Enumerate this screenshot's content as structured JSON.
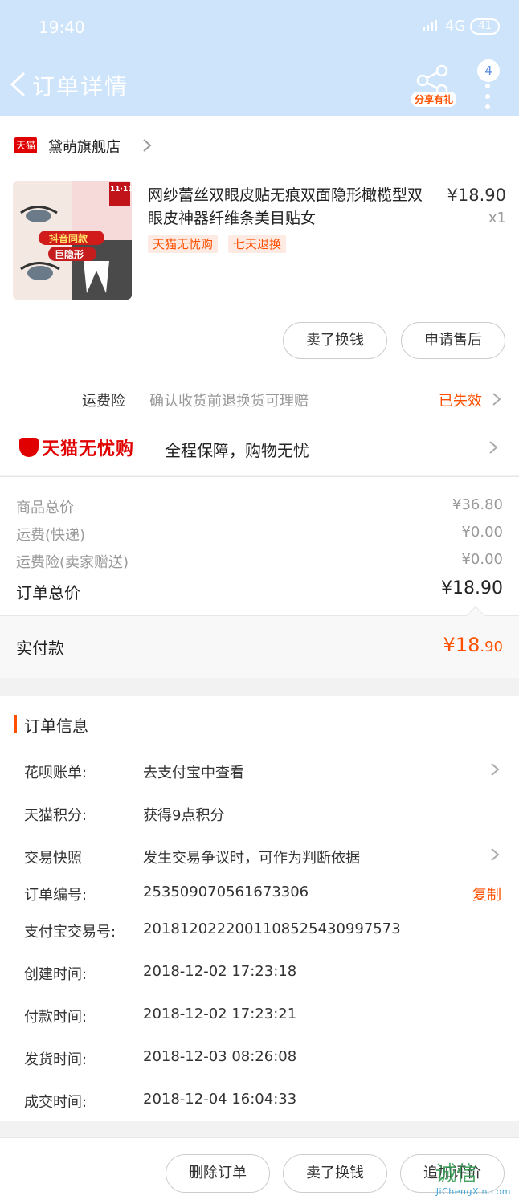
{
  "status_bar": {
    "time": "19:40",
    "network": "4G",
    "battery": "41"
  },
  "header": {
    "title": "订单详情",
    "share_label": "分享有礼",
    "badge_count": "4"
  },
  "store": {
    "logo_text": "天猫",
    "name": "黛萌旗舰店"
  },
  "product": {
    "title": "网纱蕾丝双眼皮贴无痕双面隐形橄榄型双眼皮神器纤维条美目贴女",
    "price": "¥18.90",
    "quantity": "x1",
    "tags": [
      "天猫无忧购",
      "七天退换"
    ],
    "thumb_texts": {
      "badge": "11·11",
      "banner1": "抖音同款",
      "banner2": "巨隐形"
    },
    "actions": [
      "卖了换钱",
      "申请售后"
    ]
  },
  "insurance": {
    "label": "运费险",
    "description": "确认收货前退换货可理赔",
    "status": "已失效"
  },
  "wuyou": {
    "logo_text": "天猫无忧购",
    "description": "全程保障，购物无忧"
  },
  "price_summary": {
    "rows": [
      {
        "label": "商品总价",
        "value": "¥36.80"
      },
      {
        "label": "运费(快递)",
        "value": "¥0.00"
      },
      {
        "label": "运费险(卖家赠送)",
        "value": "¥0.00"
      }
    ],
    "total_label": "订单总价",
    "total_value": "¥18.90",
    "paid_label": "实付款",
    "paid_currency_int": "¥18",
    "paid_decimal": ".90"
  },
  "order_info": {
    "title": "订单信息",
    "rows": [
      {
        "label": "花呗账单:",
        "value": "去支付宝中查看"
      },
      {
        "label": "天猫积分:",
        "value": "获得9点积分"
      },
      {
        "label": "交易快照",
        "value": "发生交易争议时，可作为判断依据"
      },
      {
        "label": "订单编号:",
        "value": "253509070561673306",
        "action": "复制"
      },
      {
        "label": "支付宝交易号:",
        "value": "2018120222001108525430997573"
      },
      {
        "label": "创建时间:",
        "value": "2018-12-02 17:23:18"
      },
      {
        "label": "付款时间:",
        "value": "2018-12-02 17:23:21"
      },
      {
        "label": "发货时间:",
        "value": "2018-12-03 08:26:08"
      },
      {
        "label": "成交时间:",
        "value": "2018-12-04 16:04:33"
      }
    ]
  },
  "bottom_actions": [
    "删除订单",
    "卖了换钱",
    "追加评价"
  ],
  "watermark": {
    "mark": "诚信",
    "url": "JiChengXin.com"
  },
  "colors": {
    "accent": "#ff5000",
    "header_bg": "#cde4fb",
    "tmall_red": "#e10000"
  }
}
